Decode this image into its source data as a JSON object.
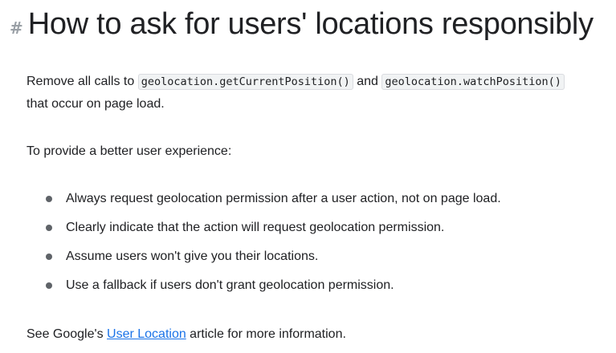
{
  "heading": {
    "anchor": "#",
    "title": "How to ask for users' locations responsibly"
  },
  "intro": {
    "text_before": "Remove all calls to ",
    "code1": "geolocation.getCurrentPosition()",
    "text_middle": " and ",
    "code2": "geolocation.watchPosition()",
    "text_after": " that occur on page load."
  },
  "lead": "To provide a better user experience:",
  "bullets": [
    "Always request geolocation permission after a user action, not on page load.",
    "Clearly indicate that the action will request geolocation permission.",
    "Assume users won't give you their locations.",
    "Use a fallback if users don't grant geolocation permission."
  ],
  "closing": {
    "text_before": "See Google's ",
    "link_label": "User Location",
    "text_after": " article for more information."
  },
  "colors": {
    "text": "#202124",
    "link": "#1a73e8",
    "code_bg": "#f1f3f4"
  }
}
